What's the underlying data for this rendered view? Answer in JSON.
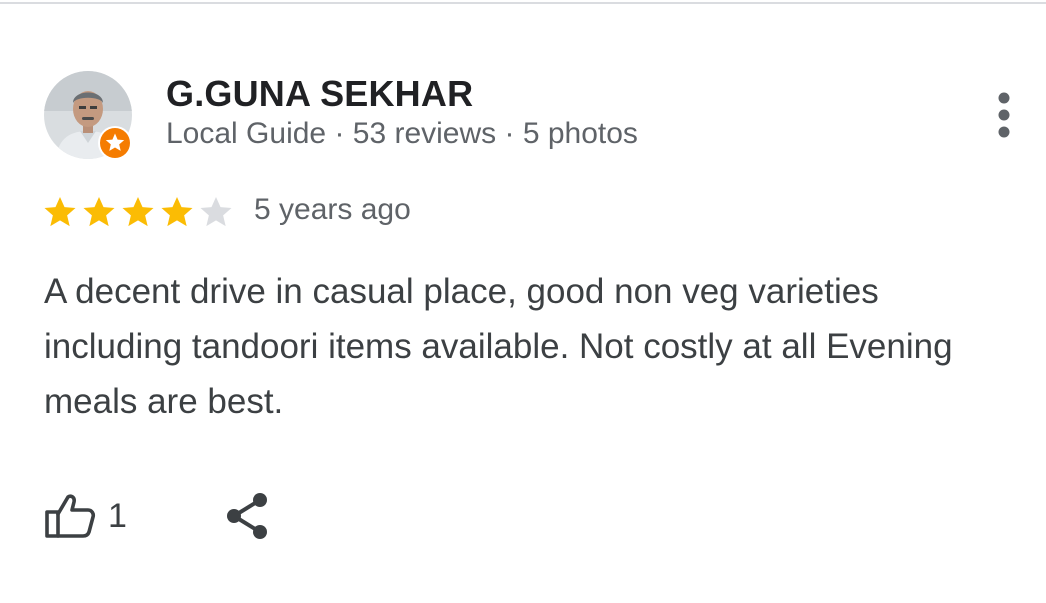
{
  "reviewer": {
    "name": "G.GUNA SEKHAR",
    "meta": "Local Guide · 53 reviews · 5 photos",
    "avatar_icon": "person-photo-avatar",
    "badge_icon": "local-guide-star-badge"
  },
  "review": {
    "rating": 4,
    "max_rating": 5,
    "time": "5 years ago",
    "text": "A decent drive in casual place, good non veg varieties including tandoori items available. Not costly at all Evening meals are best."
  },
  "actions": {
    "like_count": "1",
    "like_icon": "thumbs-up-icon",
    "share_icon": "share-icon",
    "more_icon": "more-vert-icon"
  },
  "colors": {
    "star_filled": "#fbbc04",
    "star_empty": "#dadce0",
    "badge": "#f57c00",
    "secondary_text": "#5f6368"
  }
}
